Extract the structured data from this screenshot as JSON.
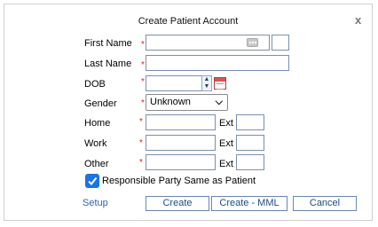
{
  "dialog": {
    "title": "Create Patient Account",
    "close_label": "x"
  },
  "fields": {
    "first_name": {
      "label": "First Name",
      "value": ""
    },
    "last_name": {
      "label": "Last Name",
      "value": ""
    },
    "dob": {
      "label": "DOB",
      "value": ""
    },
    "gender": {
      "label": "Gender",
      "value": "Unknown"
    },
    "home": {
      "label": "Home",
      "value": "",
      "ext_label": "Ext",
      "ext_value": ""
    },
    "work": {
      "label": "Work",
      "value": "",
      "ext_label": "Ext",
      "ext_value": ""
    },
    "other": {
      "label": "Other",
      "value": "",
      "ext_label": "Ext",
      "ext_value": ""
    }
  },
  "required_marker": "*",
  "responsible_party": {
    "label": "Responsible Party Same as Patient",
    "checked": true
  },
  "footer": {
    "setup_label": "Setup",
    "create_label": "Create",
    "create_mml_label": "Create - MML",
    "cancel_label": "Cancel"
  },
  "colors": {
    "required": "#e02020",
    "link": "#2d63b5",
    "checkbox": "#1a73e8"
  }
}
